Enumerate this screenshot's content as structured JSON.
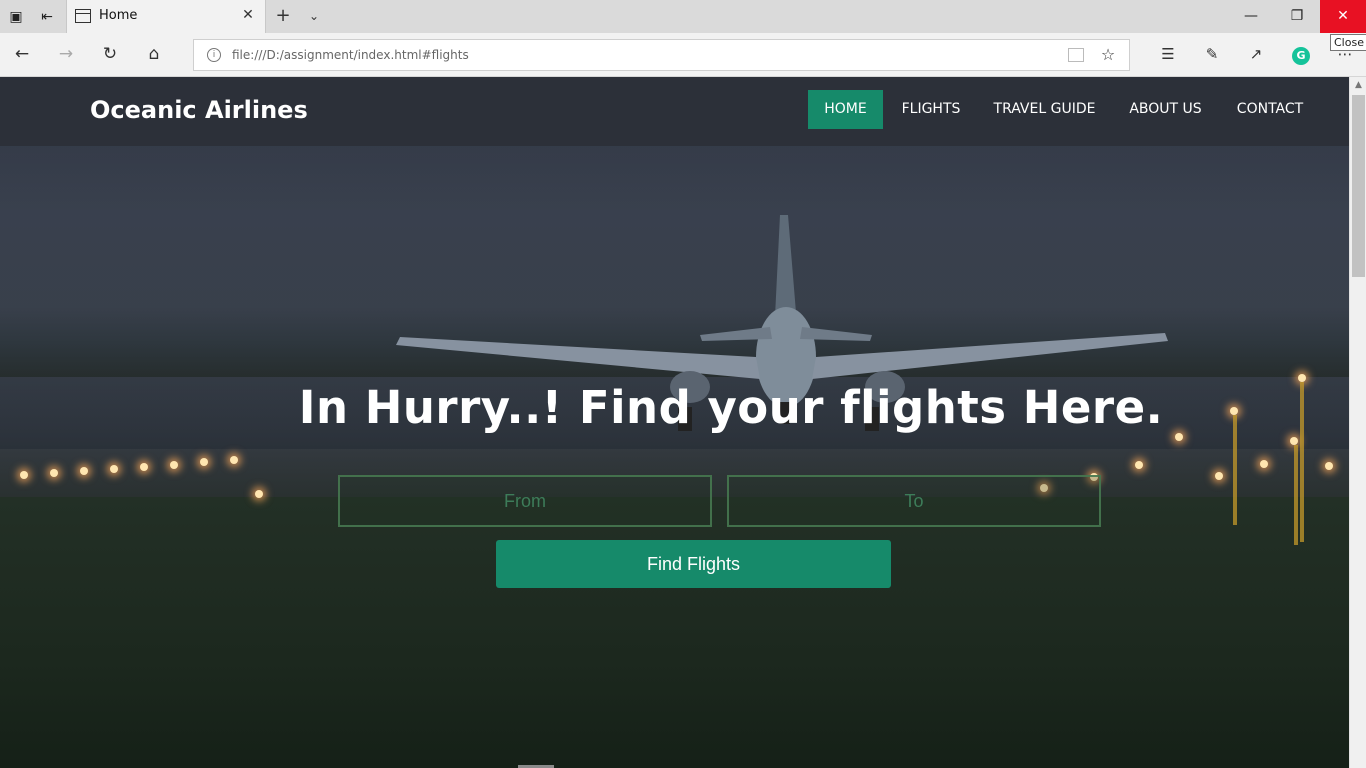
{
  "browser": {
    "tab_title": "Home",
    "address_url": "file:///D:/assignment/index.html#flights",
    "tooltip": "Close",
    "icons": {
      "tab_actions": "tab-actions-icon",
      "set_aside": "set-aside-tabs-icon",
      "tab_page": "page-icon",
      "tab_close": "close-icon",
      "new_tab": "plus-icon",
      "tab_list": "chevron-down-icon",
      "back": "back-arrow-icon",
      "forward": "forward-arrow-icon",
      "refresh": "refresh-icon",
      "home": "home-icon",
      "site_info": "info-icon",
      "reading_view": "reading-view-icon",
      "favorite": "star-icon",
      "favorites_hub": "favorites-hub-icon",
      "notes": "pen-icon",
      "share": "share-icon",
      "grammarly": "grammarly-icon",
      "more": "more-icon",
      "minimize": "minimize-icon",
      "maximize": "restore-icon",
      "window_close": "close-icon"
    }
  },
  "site": {
    "brand": "Oceanic Airlines",
    "menu": [
      {
        "label": "HOME",
        "active": true
      },
      {
        "label": "FLIGHTS",
        "active": false
      },
      {
        "label": "TRAVEL GUIDE",
        "active": false
      },
      {
        "label": "ABOUT US",
        "active": false
      },
      {
        "label": "CONTACT",
        "active": false
      }
    ]
  },
  "hero": {
    "title": "In Hurry..! Find your flights Here.",
    "from_placeholder": "From",
    "to_placeholder": "To",
    "button_label": "Find Flights"
  },
  "colors": {
    "accent": "#168a6a",
    "header_bg": "#2c3039",
    "window_close": "#e81123"
  }
}
